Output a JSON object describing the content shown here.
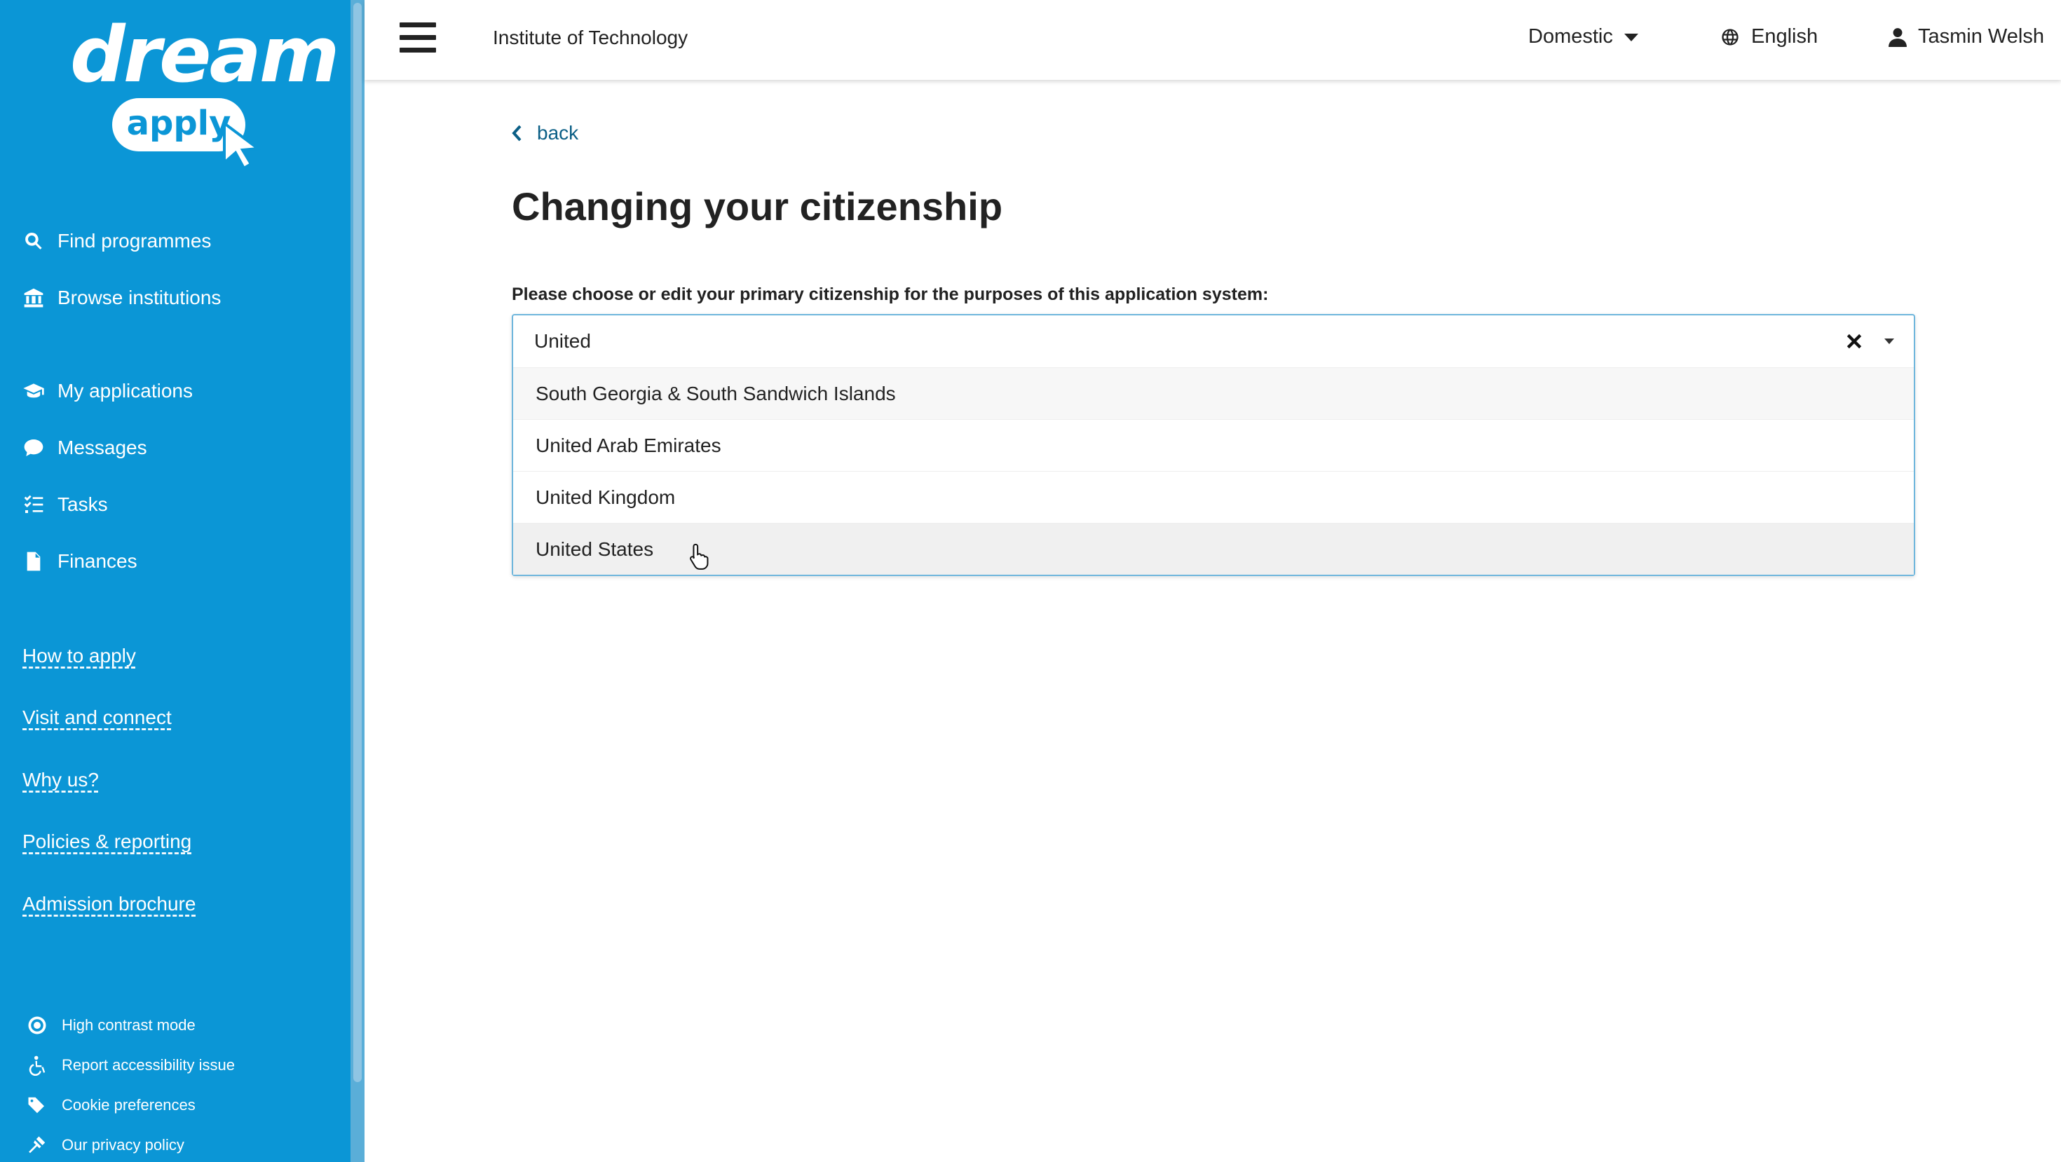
{
  "brand": {
    "word": "dream",
    "pill": "apply"
  },
  "sidebar": {
    "nav_primary": [
      {
        "label": "Find programmes",
        "icon": "search-icon"
      },
      {
        "label": "Browse institutions",
        "icon": "institution-icon"
      }
    ],
    "nav_secondary": [
      {
        "label": "My applications",
        "icon": "graduation-cap-icon"
      },
      {
        "label": "Messages",
        "icon": "chat-bubble-icon"
      },
      {
        "label": "Tasks",
        "icon": "task-list-icon"
      },
      {
        "label": "Finances",
        "icon": "document-icon"
      }
    ],
    "links": [
      "How to apply",
      "Visit and connect",
      "Why us?",
      "Policies & reporting",
      "Admission brochure"
    ],
    "footer": [
      {
        "label": "High contrast mode",
        "icon": "contrast-icon"
      },
      {
        "label": "Report accessibility issue",
        "icon": "wheelchair-icon"
      },
      {
        "label": "Cookie preferences",
        "icon": "tags-icon"
      },
      {
        "label": "Our privacy policy",
        "icon": "gavel-icon"
      }
    ]
  },
  "header": {
    "institution": "Institute of Technology",
    "mode": "Domestic",
    "language": "English",
    "user": "Tasmin Welsh"
  },
  "main": {
    "back_label": "back",
    "title": "Changing your citizenship",
    "field_label": "Please choose or edit your primary citizenship for the purposes of this application system:",
    "search_value": "United",
    "options": [
      "South Georgia & South Sandwich Islands",
      "United Arab Emirates",
      "United Kingdom",
      "United States"
    ]
  },
  "colors": {
    "sidebar_bg": "#0b96d6",
    "link": "#0b5f86",
    "select_border": "#6fb6dc"
  }
}
